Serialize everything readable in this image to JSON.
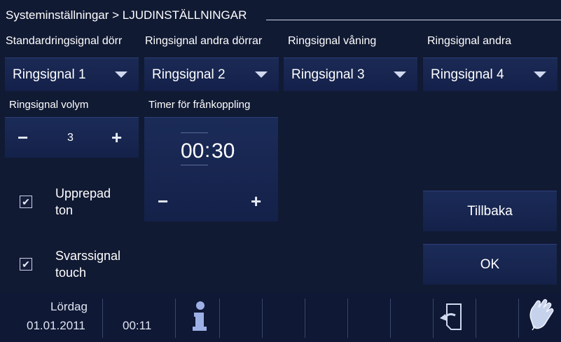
{
  "header": {
    "breadcrumb": "Systeminställningar > LJUDINSTÄLLNINGAR"
  },
  "ringtones": [
    {
      "label": "Standardringsignal dörr",
      "value": "Ringsignal 1"
    },
    {
      "label": "Ringsignal andra dörrar",
      "value": "Ringsignal 2"
    },
    {
      "label": "Ringsignal våning",
      "value": "Ringsignal 3"
    },
    {
      "label": "Ringsignal andra",
      "value": "Ringsignal 4"
    }
  ],
  "volume": {
    "label": "Ringsignal volym",
    "value": "3",
    "minus": "−",
    "plus": "+"
  },
  "timer": {
    "label": "Timer för frånkoppling",
    "minutes": "00",
    "sep": ":",
    "seconds": "30",
    "minus": "−",
    "plus": "+"
  },
  "options": [
    {
      "line1": "Upprepad",
      "line2": "ton",
      "checked": true,
      "mark": "✔"
    },
    {
      "line1": "Svarssignal",
      "line2": "touch",
      "checked": true,
      "mark": "✔"
    }
  ],
  "buttons": {
    "back": "Tillbaka",
    "ok": "OK"
  },
  "statusbar": {
    "day": "Lördag",
    "date": "01.01.2011",
    "time": "00:11"
  },
  "icons": {
    "info": "info-icon",
    "return": "return-icon",
    "touch": "hand-touch-icon"
  },
  "colors": {
    "background": "#111a33",
    "panel": "#182650",
    "text": "#ffffff",
    "info_icon": "#9db0e6"
  }
}
